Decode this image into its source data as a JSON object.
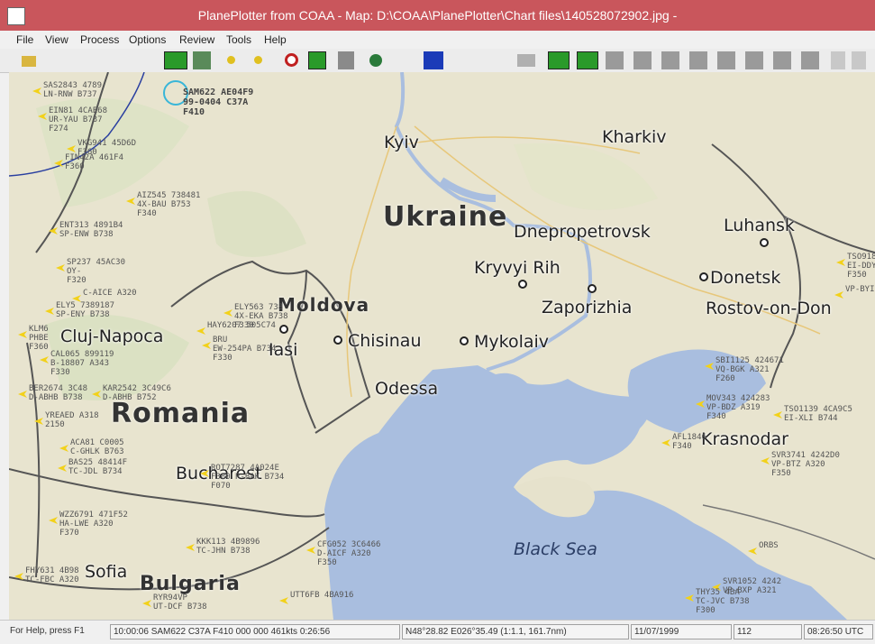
{
  "window": {
    "title": "PlanePlotter from COAA - Map: D:\\COAA\\PlanePlotter\\Chart files\\140528072902.jpg -"
  },
  "menu": [
    "File",
    "View",
    "Process",
    "Options",
    "Review",
    "Tools",
    "Help"
  ],
  "toolbar": {
    "icons": [
      "open-folder-icon",
      "map-view-icon",
      "route-icon",
      "yellow-dot-icon",
      "yellow-dot-icon",
      "target-icon",
      "wrench-green-icon",
      "tools-icon",
      "globe-icon",
      "pen-icon",
      "radar-icon",
      "chart-icon-1",
      "chart-icon-2"
    ]
  },
  "map": {
    "countries": [
      "Ukraine",
      "Romania",
      "Bulgaria",
      "Moldova"
    ],
    "sea": "Black Sea",
    "cities": [
      {
        "name": "Kyiv"
      },
      {
        "name": "Kharkiv"
      },
      {
        "name": "Dnepropetrovsk"
      },
      {
        "name": "Luhansk"
      },
      {
        "name": "Kryvyi Rih"
      },
      {
        "name": "Donetsk"
      },
      {
        "name": "Zaporizhia"
      },
      {
        "name": "Rostov-on-Don"
      },
      {
        "name": "Chisinau"
      },
      {
        "name": "Iasi"
      },
      {
        "name": "Mykolaiv"
      },
      {
        "name": "Odessa"
      },
      {
        "name": "Cluj-Napoca"
      },
      {
        "name": "Krasnodar"
      },
      {
        "name": "Bucharest"
      },
      {
        "name": "Sofia"
      }
    ],
    "selected_aircraft": {
      "line1": "SAM622 AE04F9",
      "line2": "99-0404 C37A",
      "line3": "F410"
    },
    "aircraft": [
      {
        "l1": "SAS2843 4789",
        "l2": "LN-RNW B737",
        "l3": ""
      },
      {
        "l1": "EIN81 4CAE68",
        "l2": "UR-YAU B737",
        "l3": "F274"
      },
      {
        "l1": "VKG941 45D6D",
        "l2": "",
        "l3": "F360"
      },
      {
        "l1": "FIN42A 461F4",
        "l2": "",
        "l3": "F360"
      },
      {
        "l1": "AIZ545 738481",
        "l2": "4X-BAU B753",
        "l3": "F340"
      },
      {
        "l1": "ENT313 4891B4",
        "l2": "SP-ENW B738",
        "l3": ""
      },
      {
        "l1": "SP237 45AC30",
        "l2": "OY-",
        "l3": "F320"
      },
      {
        "l1": "C-AICE A320",
        "l2": "",
        "l3": ""
      },
      {
        "l1": "ELY5 7389187",
        "l2": "SP-ENY B738",
        "l3": ""
      },
      {
        "l1": "ELY563 738",
        "l2": "4X-EKA B738",
        "l3": "F330"
      },
      {
        "l1": "HAY6207 505C74",
        "l2": "",
        "l3": ""
      },
      {
        "l1": "KLM6",
        "l2": "PHBE",
        "l3": "F360"
      },
      {
        "l1": "BRU",
        "l2": "EW-254PA B734",
        "l3": "F330"
      },
      {
        "l1": "CAL065 899119",
        "l2": "B-18807 A343",
        "l3": "F330"
      },
      {
        "l1": "BER2674 3C48",
        "l2": "D-ABHB B738",
        "l3": ""
      },
      {
        "l1": "KAR2542 3C49C6",
        "l2": "D-ABHB B752",
        "l3": ""
      },
      {
        "l1": "YREAED A318",
        "l2": "2150",
        "l3": ""
      },
      {
        "l1": "ACA81 C0005",
        "l2": "C-GHLK B763",
        "l3": ""
      },
      {
        "l1": "BAS25 48414F",
        "l2": "TC-JDL B734",
        "l3": ""
      },
      {
        "l1": "ROT7287 4A024E",
        "l2": "F380 R-BAK B734",
        "l3": "F070"
      },
      {
        "l1": "WZZ6791 471F52",
        "l2": "HA-LWE A320",
        "l3": "F370"
      },
      {
        "l1": "KKK113 4B9896",
        "l2": "TC-JHN B738",
        "l3": ""
      },
      {
        "l1": "CFG052 3C6466",
        "l2": "D-AICF A320",
        "l3": "F350"
      },
      {
        "l1": "FHY631 4B98",
        "l2": "TC-FBC A320",
        "l3": ""
      },
      {
        "l1": "RYR94VP",
        "l2": "UT-DCF B738",
        "l3": ""
      },
      {
        "l1": "UTT6FB 4BA916",
        "l2": "",
        "l3": ""
      },
      {
        "l1": "SBI1125 424671",
        "l2": "VQ-BGK A321",
        "l3": "F260"
      },
      {
        "l1": "MOV343 424283",
        "l2": "VP-BDZ A319",
        "l3": "F340"
      },
      {
        "l1": "TSO1139 4CA9C5",
        "l2": "EI-XLI B744",
        "l3": ""
      },
      {
        "l1": "AFL1846",
        "l2": "",
        "l3": "F340"
      },
      {
        "l1": "SVR3741 4242D0",
        "l2": "VP-BTZ A320",
        "l3": "F350"
      },
      {
        "l1": "TSO9187 4CA",
        "l2": "EI-DDY B734",
        "l3": "F350"
      },
      {
        "l1": "VP-BYI B735",
        "l2": "",
        "l3": ""
      },
      {
        "l1": "SVR1052 4242",
        "l2": "VP-BXP A321",
        "l3": ""
      },
      {
        "l1": "THY35 4BA",
        "l2": "TC-JVC B738",
        "l3": "F300"
      },
      {
        "l1": "ORBS",
        "l2": "",
        "l3": ""
      }
    ]
  },
  "status": {
    "help": "For Help, press F1",
    "aircraft_info": "10:00:06 SAM622 C37A F410 000 000 461kts 0:26:56",
    "position": "N48°28.82 E026°35.49 (1:1.1, 161.7nm)",
    "date": "11/07/1999",
    "count": "112",
    "time": "08:26:50 UTC"
  }
}
